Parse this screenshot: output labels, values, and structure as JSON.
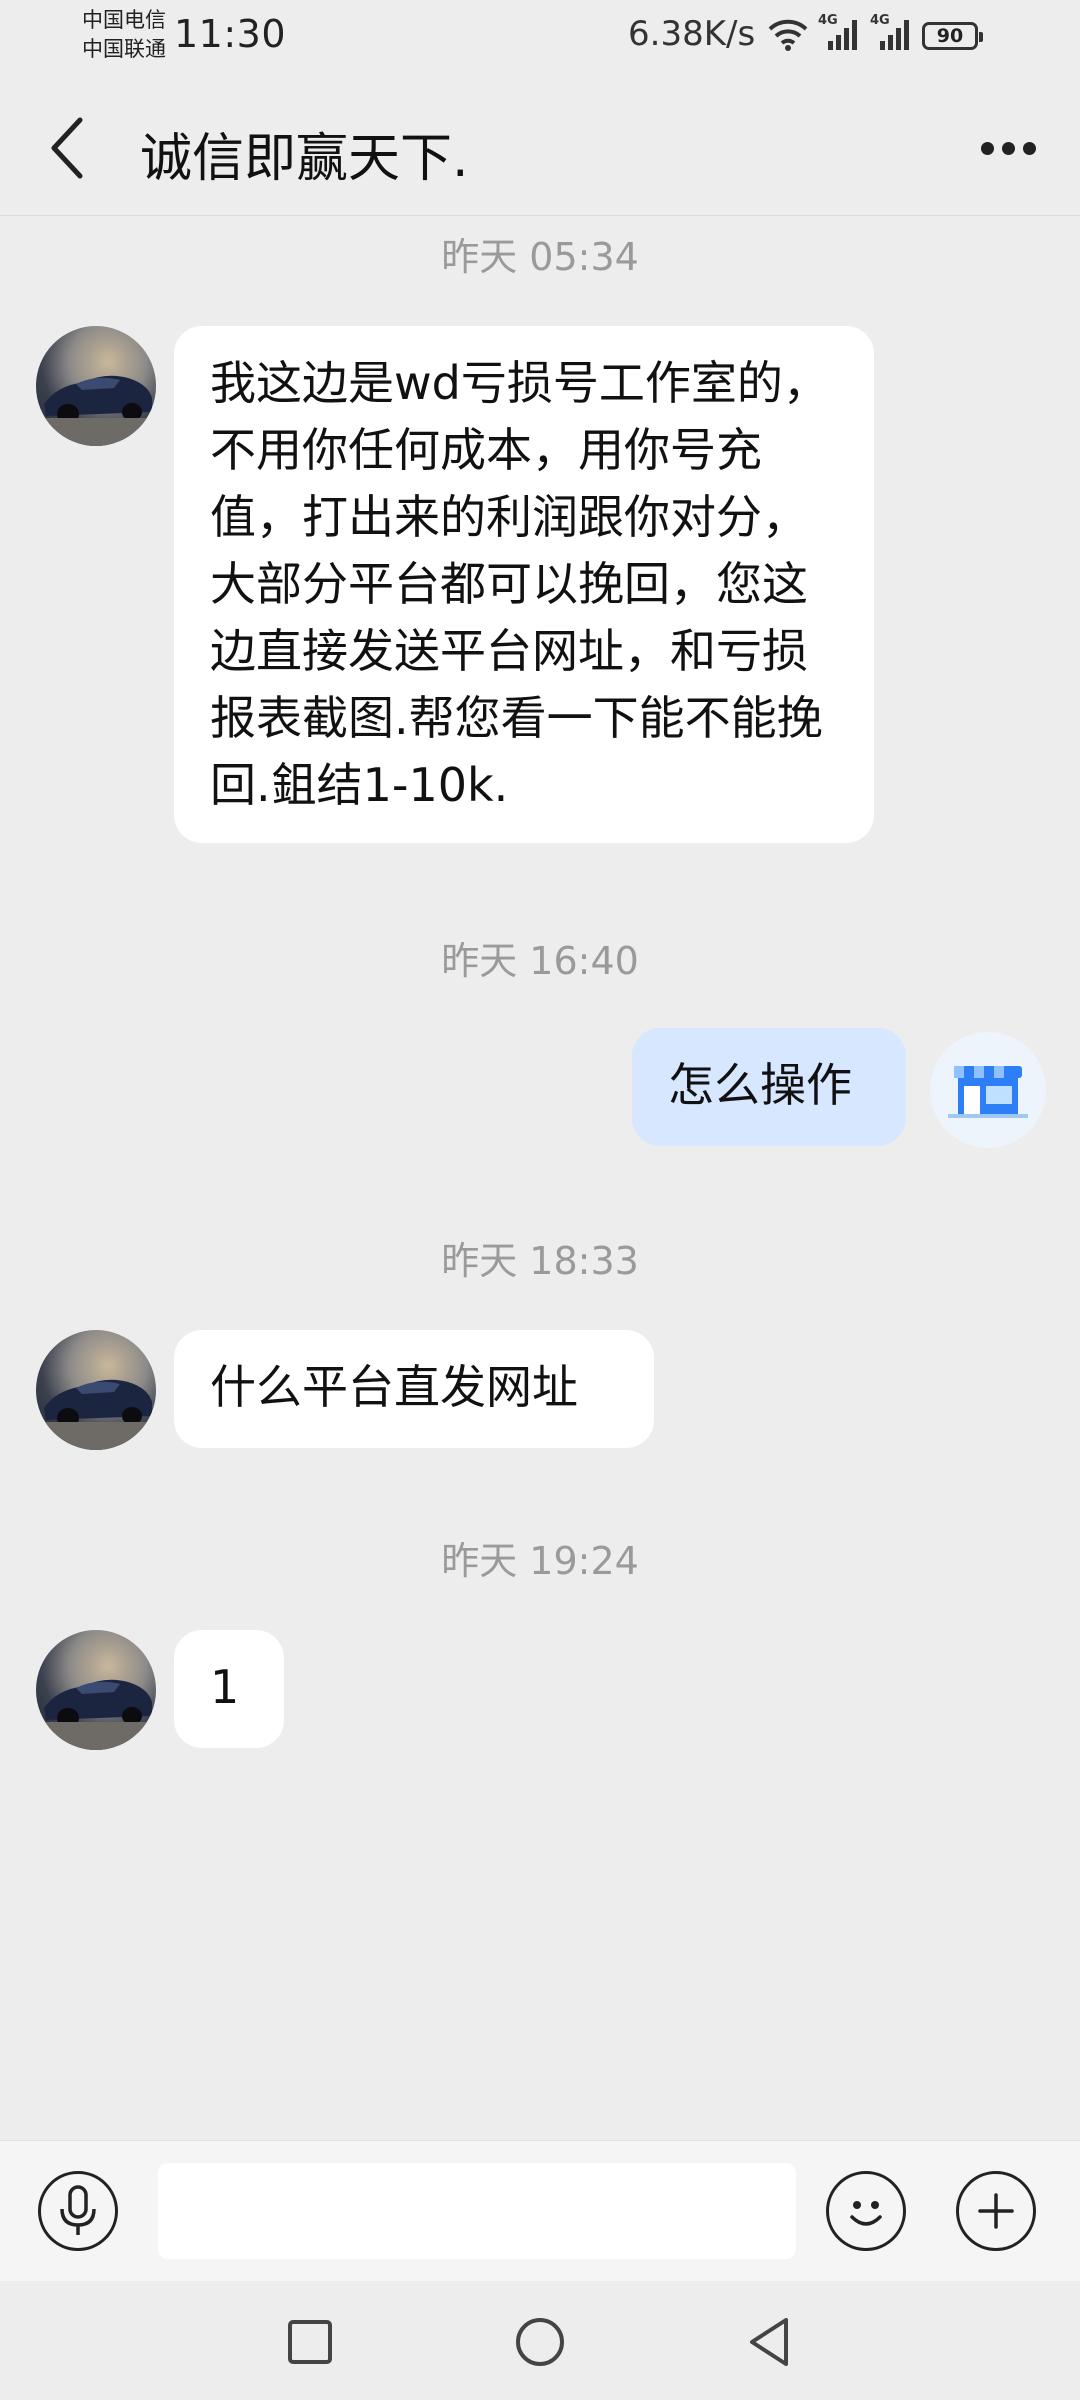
{
  "status_bar": {
    "carrier_1": "中国电信",
    "carrier_2": "中国联通",
    "time": "11:30",
    "network_speed": "6.38K/s",
    "signal_1_label": "4G",
    "signal_2_label": "4G",
    "battery": "90",
    "icons": [
      "wifi-icon",
      "signal-icon",
      "signal-icon",
      "battery-icon"
    ]
  },
  "header": {
    "title": "诚信即赢天下.",
    "back_icon": "back-chevron-icon",
    "more_icon": "more-dots-icon"
  },
  "messages": [
    {
      "timestamp": "昨天 05:34",
      "side": "left",
      "text": "我这边是wd亏损号工作室的，不用你任何成本，用你号充值，打出来的利润跟你对分，大部分平台都可以挽回，您这边直接发送平台网址，和亏损报表截图.帮您看一下能不能挽回.鉏结1-10k."
    },
    {
      "timestamp": "昨天 16:40",
      "side": "right",
      "text": "怎么操作"
    },
    {
      "timestamp": "昨天 18:33",
      "side": "left",
      "text": "什么平台直发网址"
    },
    {
      "timestamp": "昨天 19:24",
      "side": "left",
      "text": "1"
    }
  ],
  "input_bar": {
    "voice_icon": "microphone-icon",
    "input_value": "",
    "emoji_icon": "emoji-icon",
    "plus_icon": "plus-icon"
  },
  "nav_bar": {
    "icons": [
      "recents-square-icon",
      "home-circle-icon",
      "back-triangle-icon"
    ]
  },
  "colors": {
    "background": "#ededed",
    "incoming_bubble": "#ffffff",
    "outgoing_bubble": "#d7e7ff",
    "timestamp": "#9a9a9a"
  }
}
